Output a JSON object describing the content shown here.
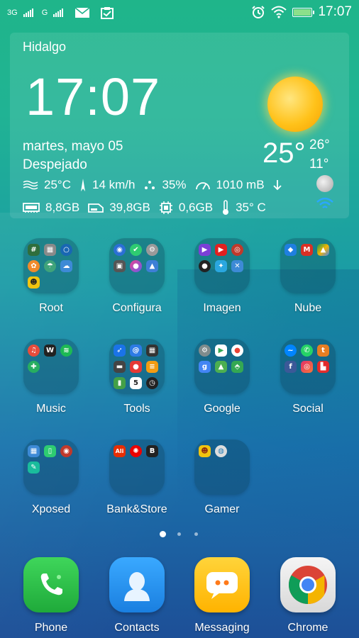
{
  "status_bar": {
    "sim1": "3G",
    "sim2": "G",
    "time": "17:07"
  },
  "weather": {
    "city": "Hidalgo",
    "time": "17:07",
    "date": "martes, mayo 05",
    "condition": "Despejado",
    "temp": "25°",
    "high": "26°",
    "low": "11°",
    "air_temp": "25°C",
    "wind": "14 km/h",
    "humidity": "35%",
    "pressure": "1010 mB",
    "ram": "8,8GB",
    "storage": "39,8GB",
    "cpu_mem": "0,6GB",
    "cpu_temp": "35° C"
  },
  "folders": [
    {
      "label": "Root"
    },
    {
      "label": "Configura"
    },
    {
      "label": "Imagen"
    },
    {
      "label": "Nube"
    },
    {
      "label": "Music"
    },
    {
      "label": "Tools"
    },
    {
      "label": "Google"
    },
    {
      "label": "Social"
    },
    {
      "label": "Xposed"
    },
    {
      "label": "Bank&Store"
    },
    {
      "label": "Gamer"
    }
  ],
  "pager": {
    "pages": 3,
    "active": 1
  },
  "dock": [
    {
      "label": "Phone",
      "icon": "phone-icon",
      "color": "#29c44a"
    },
    {
      "label": "Contacts",
      "icon": "contacts-icon",
      "color": "#1e8ff0"
    },
    {
      "label": "Messaging",
      "icon": "messaging-icon",
      "color": "#ffc61a"
    },
    {
      "label": "Chrome",
      "icon": "chrome-icon",
      "color": "#db4437"
    }
  ],
  "colors": {
    "background_top": "#1fb58a",
    "background_bottom": "#1d4f97",
    "sun": "#ffc21a"
  }
}
